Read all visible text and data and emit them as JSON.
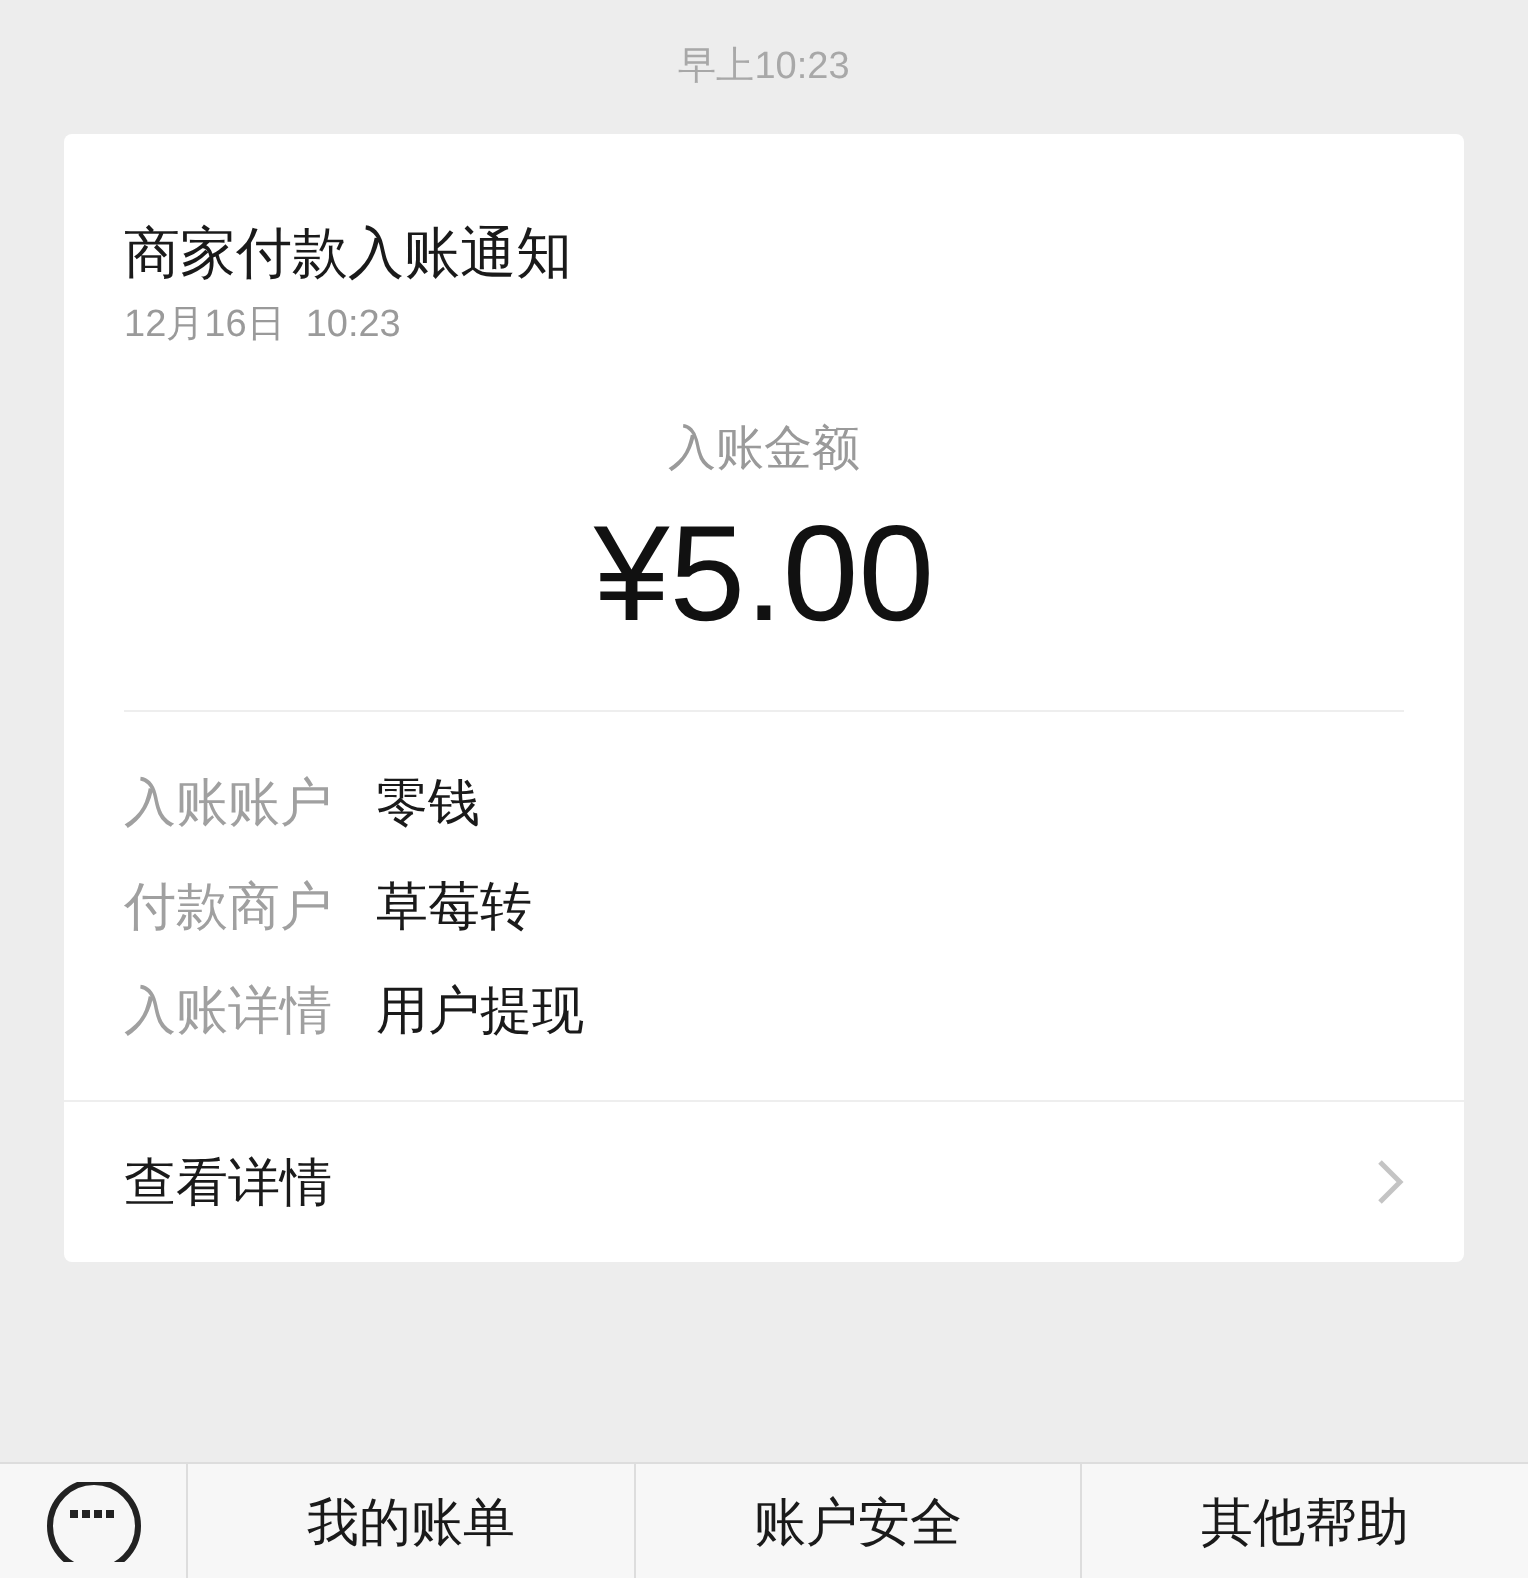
{
  "timestamp": "早上10:23",
  "card": {
    "title": "商家付款入账通知",
    "date": "12月16日  10:23",
    "amount_label": "入账金额",
    "amount": "¥5.00",
    "rows": [
      {
        "label": "入账账户",
        "value": "零钱"
      },
      {
        "label": "付款商户",
        "value": "草莓转"
      },
      {
        "label": "入账详情",
        "value": "用户提现"
      }
    ],
    "link": "查看详情"
  },
  "menu": [
    "我的账单",
    "账户安全",
    "其他帮助"
  ]
}
